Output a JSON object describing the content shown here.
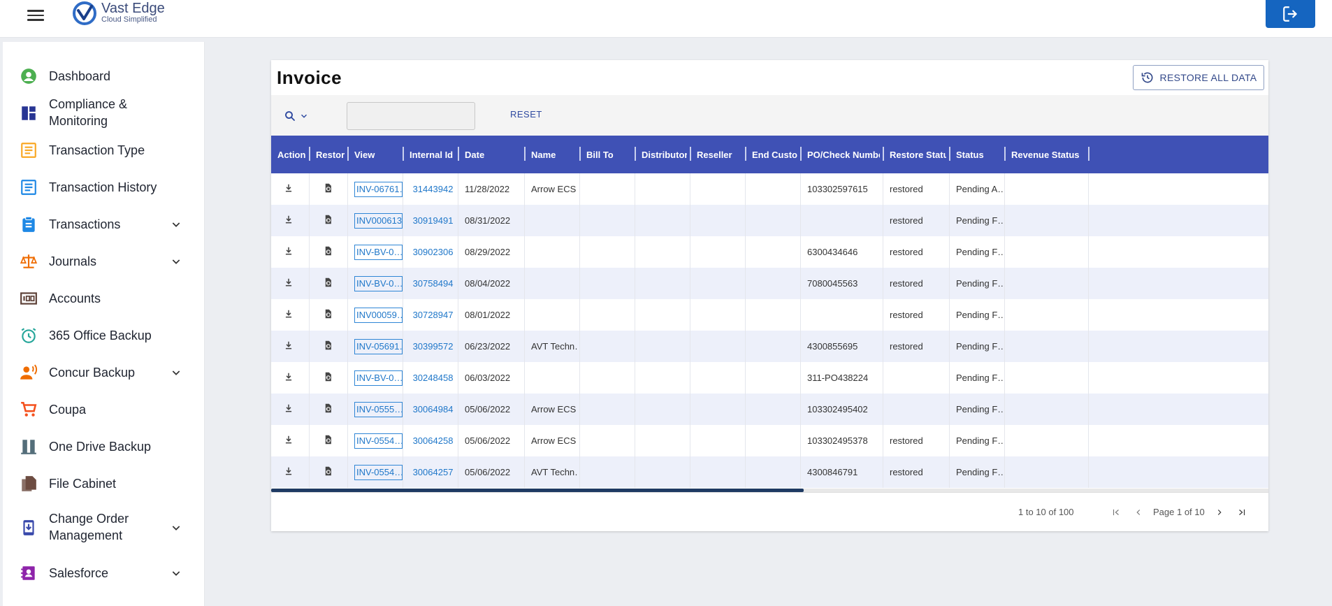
{
  "header": {
    "logo_name": "Vast Edge",
    "logo_tagline": "Cloud Simplified",
    "icons": {
      "menu": "hamburger-icon",
      "logout": "logout-icon"
    }
  },
  "sidebar": {
    "items": [
      {
        "label": "Dashboard",
        "icon": "account-circle-icon",
        "color": "#4CAF50",
        "has_submenu": false
      },
      {
        "label": "Compliance &",
        "label2": "Monitoring",
        "icon": "dashboard-tiles-icon",
        "color": "#283593",
        "has_submenu": false
      },
      {
        "label": "Transaction Type",
        "icon": "document-list-icon",
        "color": "#F9A825",
        "has_submenu": false
      },
      {
        "label": "Transaction History",
        "icon": "document-list-icon",
        "color": "#1E88E5",
        "has_submenu": false
      },
      {
        "label": "Transactions",
        "icon": "clipboard-icon",
        "color": "#1E88E5",
        "has_submenu": true
      },
      {
        "label": "Journals",
        "icon": "scales-icon",
        "color": "#EF6C00",
        "has_submenu": true
      },
      {
        "label": "Accounts",
        "icon": "counter-100-icon",
        "color": "#5D4037",
        "has_submenu": false
      },
      {
        "label": "365 Office Backup",
        "icon": "alarm-clock-icon",
        "color": "#26A69A",
        "has_submenu": false
      },
      {
        "label": "Concur Backup",
        "icon": "person-voice-icon",
        "color": "#EF6C00",
        "has_submenu": true
      },
      {
        "label": "Coupa",
        "icon": "shopping-cart-icon",
        "color": "#F4511E",
        "has_submenu": false
      },
      {
        "label": "One Drive Backup",
        "icon": "door-panel-icon",
        "color": "#546E7A",
        "has_submenu": false
      },
      {
        "label": "File Cabinet",
        "icon": "file-copy-icon",
        "color": "#6D4C41",
        "has_submenu": false
      },
      {
        "label": "Change Order",
        "label2": "Management",
        "icon": "phone-download-icon",
        "color": "#3949AB",
        "has_submenu": true
      },
      {
        "label": "Salesforce",
        "icon": "contacts-book-icon",
        "color": "#8E24AA",
        "has_submenu": true
      }
    ]
  },
  "page": {
    "title": "Invoice",
    "restore_all_label": "RESTORE ALL DATA",
    "reset_label": "RESET",
    "search_value": "",
    "search_placeholder": ""
  },
  "table": {
    "columns": [
      "Action",
      "Restore",
      "View",
      "Internal Id",
      "Date",
      "Name",
      "Bill To",
      "Distributor",
      "Reseller",
      "End Custo…",
      "PO/Check Number",
      "Restore Status",
      "Status",
      "Revenue Status"
    ],
    "rows": [
      {
        "view": "INV-06761…",
        "internal_id": "31443942",
        "date": "11/28/2022",
        "name": "Arrow ECS …",
        "po": "103302597615",
        "restore_status": "restored",
        "status": "Pending A…"
      },
      {
        "view": "INV000613…",
        "internal_id": "30919491",
        "date": "08/31/2022",
        "name": "",
        "po": "",
        "restore_status": "restored",
        "status": "Pending F…"
      },
      {
        "view": "INV-BV-0…",
        "internal_id": "30902306",
        "date": "08/29/2022",
        "name": "",
        "po": "6300434646",
        "restore_status": "restored",
        "status": "Pending F…"
      },
      {
        "view": "INV-BV-0…",
        "internal_id": "30758494",
        "date": "08/04/2022",
        "name": "",
        "po": "7080045563",
        "restore_status": "restored",
        "status": "Pending F…"
      },
      {
        "view": "INV00059…",
        "internal_id": "30728947",
        "date": "08/01/2022",
        "name": "",
        "po": "",
        "restore_status": "restored",
        "status": "Pending F…"
      },
      {
        "view": "INV-05691…",
        "internal_id": "30399572",
        "date": "06/23/2022",
        "name": "AVT Techn…",
        "po": "4300855695",
        "restore_status": "restored",
        "status": "Pending F…"
      },
      {
        "view": "INV-BV-0…",
        "internal_id": "30248458",
        "date": "06/03/2022",
        "name": "",
        "po": "311-PO438224",
        "restore_status": "",
        "status": "Pending F…"
      },
      {
        "view": "INV-0555…",
        "internal_id": "30064984",
        "date": "05/06/2022",
        "name": "Arrow ECS …",
        "po": "103302495402",
        "restore_status": "",
        "status": "Pending F…"
      },
      {
        "view": "INV-0554…",
        "internal_id": "30064258",
        "date": "05/06/2022",
        "name": "Arrow ECS …",
        "po": "103302495378",
        "restore_status": "restored",
        "status": "Pending F…"
      },
      {
        "view": "INV-0554…",
        "internal_id": "30064257",
        "date": "05/06/2022",
        "name": "AVT Techn…",
        "po": "4300846791",
        "restore_status": "restored",
        "status": "Pending F…"
      }
    ]
  },
  "pagination": {
    "summary": "1 to 10 of 100",
    "page_label": "Page 1 of 10"
  },
  "colors": {
    "header_bg": "#3F51B5",
    "link": "#1f77c9",
    "logout_bg": "#1565C0",
    "row_alt": "#EDF0FA"
  }
}
